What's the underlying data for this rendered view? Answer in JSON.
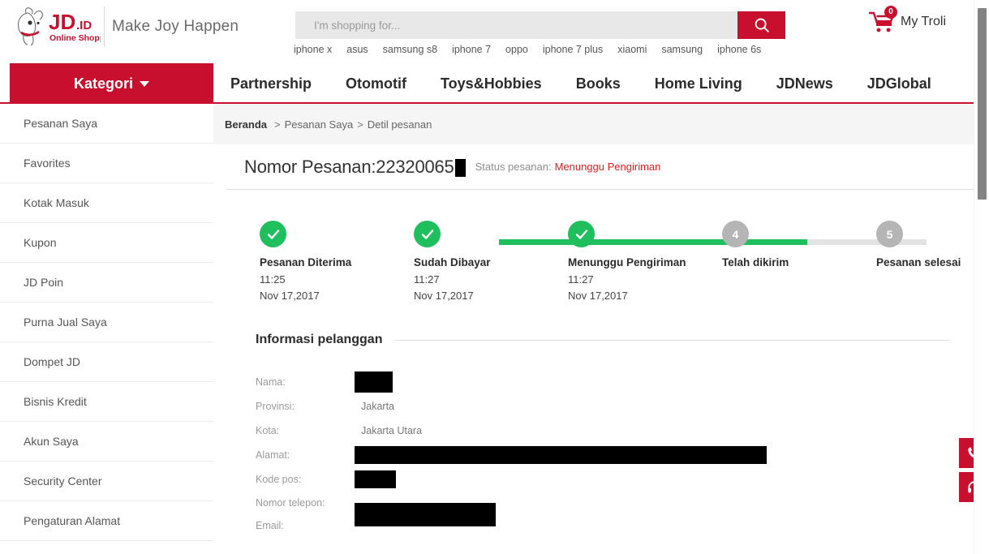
{
  "header": {
    "logo_text": "JD.ID",
    "logo_sub": "Online Shopping",
    "tagline": "Make Joy Happen",
    "search": {
      "placeholder": "I'm shopping for...",
      "value": "",
      "button_icon": "search-icon"
    },
    "hot_words": [
      "iphone x",
      "asus",
      "samsung s8",
      "iphone 7",
      "oppo",
      "iphone 7 plus",
      "xiaomi",
      "samsung",
      "iphone 6s"
    ],
    "cart": {
      "label": "My Troli",
      "count": "0",
      "icon": "shopping-cart-icon"
    }
  },
  "nav": {
    "kategori": "Kategori",
    "items": [
      "Partnership",
      "Otomotif",
      "Toys&Hobbies",
      "Books",
      "Home Living",
      "JDNews",
      "JDGlobal"
    ]
  },
  "sidebar": {
    "items": [
      "Pesanan Saya",
      "Favorites",
      "Kotak Masuk",
      "Kupon",
      "JD Poin",
      "Purna Jual Saya",
      "Dompet JD",
      "Bisnis Kredit",
      "Akun Saya",
      "Security Center",
      "Pengaturan Alamat"
    ]
  },
  "breadcrumb": {
    "home": "Beranda",
    "sep1": ">",
    "level2": "Pesanan Saya",
    "sep2": ">",
    "current": "Detil pesanan"
  },
  "order": {
    "number_label": "Nomor Pesanan:",
    "number_value": "22320065",
    "number_redacted": true,
    "status_label": "Status pesanan:",
    "status_value": "Menunggu Pengiriman",
    "status_color": "#e02020"
  },
  "stepper": {
    "done_color": "#1fbf5e",
    "pending_color": "#b5b5b5",
    "steps": [
      {
        "index": "1",
        "title": "Pesanan Diterima",
        "time": "11:25",
        "date": "Nov 17,2017",
        "state": "done"
      },
      {
        "index": "2",
        "title": "Sudah Dibayar",
        "time": "11:27",
        "date": "Nov 17,2017",
        "state": "done"
      },
      {
        "index": "3",
        "title": "Menunggu Pengiriman",
        "time": "11:27",
        "date": "Nov 17,2017",
        "state": "done"
      },
      {
        "index": "4",
        "title": "Telah dikirim",
        "time": "",
        "date": "",
        "state": "pending"
      },
      {
        "index": "5",
        "title": "Pesanan selesai",
        "time": "",
        "date": "",
        "state": "pending"
      }
    ]
  },
  "customer": {
    "section_title": "Informasi pelanggan",
    "rows": [
      {
        "label": "Nama:",
        "value": "",
        "redacted": true,
        "redact_w": 47
      },
      {
        "label": "Provinsi:",
        "value": "Jakarta",
        "redacted": false,
        "redact_w": 0
      },
      {
        "label": "Kota:",
        "value": "Jakarta Utara",
        "redacted": false,
        "redact_w": 0
      },
      {
        "label": "Alamat:",
        "value": "",
        "redacted": true,
        "redact_w": 508
      },
      {
        "label": "Kode pos:",
        "value": "",
        "redacted": true,
        "redact_w": 51
      },
      {
        "label": "Nomor telepon:",
        "value": "",
        "redacted": true,
        "redact_w": 174
      },
      {
        "label": "Email:",
        "value": "",
        "redacted": true,
        "redact_w": 174
      }
    ]
  },
  "floating": {
    "phone": "phone-icon",
    "headset": "headset-support-icon"
  },
  "colors": {
    "brand_red": "#c8102e",
    "status_green": "#1fbf5e",
    "grey_bar": "#f5f5f5"
  }
}
